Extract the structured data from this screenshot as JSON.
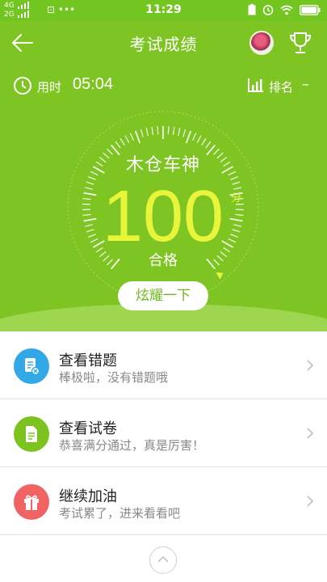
{
  "status_bar": {
    "network_top": "4G",
    "network_bottom": "2G",
    "misc": "⊡ •••",
    "time": "11:29"
  },
  "header": {
    "title": "考试成绩"
  },
  "info": {
    "time_label": "用时",
    "time_value": "05:04",
    "rank_label": "排名",
    "rank_value": "–"
  },
  "score_card": {
    "name": "木仓车神",
    "score": "100",
    "unit": "分",
    "result": "合格"
  },
  "share_button_label": "炫耀一下",
  "menu": [
    {
      "title": "查看错题",
      "subtitle": "棒极啦，没有错题哦",
      "icon": "wrong-questions-icon",
      "color": "#33a8e6"
    },
    {
      "title": "查看试卷",
      "subtitle": "恭喜满分通过，真是厉害！",
      "icon": "exam-paper-icon",
      "color": "#7cc320"
    },
    {
      "title": "继续加油",
      "subtitle": "考试累了，进来看看吧",
      "icon": "gift-icon",
      "color": "#f06363"
    }
  ],
  "colors": {
    "brand_green": "#7ec524",
    "score_yellow": "#e8f53a"
  }
}
